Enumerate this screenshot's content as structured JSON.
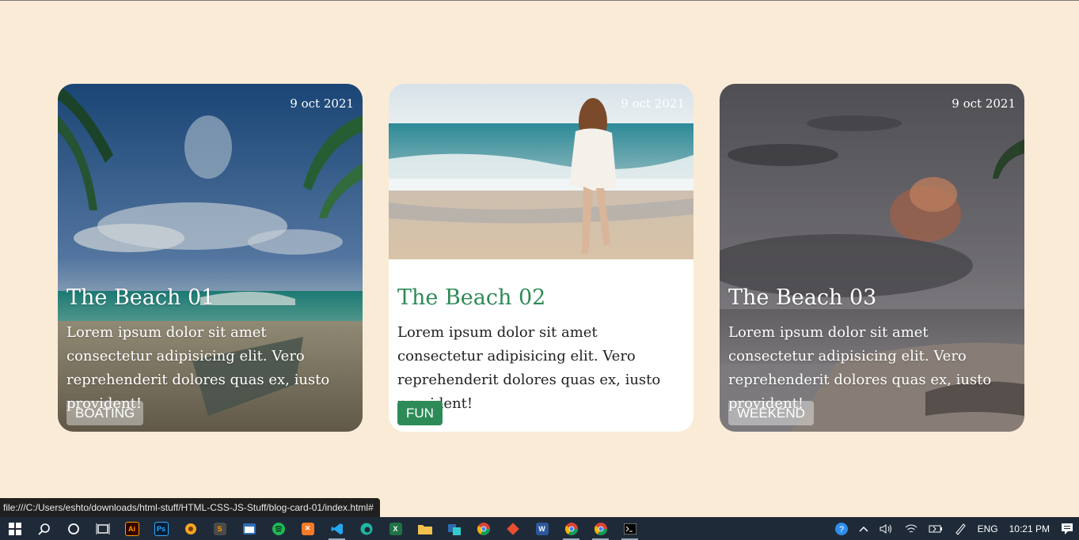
{
  "browser": {
    "status_url": "file:///C:/Users/eshto/downloads/html-stuff/HTML-CSS-JS-Stuff/blog-card-01/index.html#"
  },
  "cards": [
    {
      "date": "9 oct 2021",
      "title": "The Beach 01",
      "description": "Lorem ipsum dolor sit amet consectetur adipisicing elit. Vero reprehenderit dolores quas ex, iusto provident!",
      "tag": "BOATING"
    },
    {
      "date": "9 oct 2021",
      "title": "The Beach 02",
      "description": "Lorem ipsum dolor sit amet consectetur adipisicing elit. Vero reprehenderit dolores quas ex, iusto provident!",
      "tag": "FUN"
    },
    {
      "date": "9 oct 2021",
      "title": "The Beach 03",
      "description": "Lorem ipsum dolor sit amet consectetur adipisicing elit. Vero reprehenderit dolores quas ex, iusto provident!",
      "tag": "WEEKEND"
    }
  ],
  "colors": {
    "page_background": "#faebd7",
    "accent_green": "#2e8b57",
    "taskbar": "#1f2a38"
  },
  "taskbar": {
    "apps": [
      {
        "icon": "windows-start-icon"
      },
      {
        "icon": "search-icon"
      },
      {
        "icon": "cortana-icon"
      },
      {
        "icon": "task-view-icon"
      },
      {
        "icon": "illustrator-icon",
        "label": "Ai"
      },
      {
        "icon": "photoshop-icon",
        "label": "Ps"
      },
      {
        "icon": "app-icon"
      },
      {
        "icon": "sublime-text-icon"
      },
      {
        "icon": "app-icon"
      },
      {
        "icon": "spotify-icon"
      },
      {
        "icon": "xampp-icon"
      },
      {
        "icon": "vscode-icon"
      },
      {
        "icon": "edge-icon"
      },
      {
        "icon": "excel-icon",
        "label": "X"
      },
      {
        "icon": "file-explorer-icon"
      },
      {
        "icon": "app-icon"
      },
      {
        "icon": "chrome-icon"
      },
      {
        "icon": "git-icon"
      },
      {
        "icon": "word-icon",
        "label": "W"
      },
      {
        "icon": "chrome-icon"
      },
      {
        "icon": "chrome-icon"
      },
      {
        "icon": "terminal-icon"
      }
    ],
    "tray": {
      "language": "ENG",
      "time": "10:21 PM"
    }
  }
}
